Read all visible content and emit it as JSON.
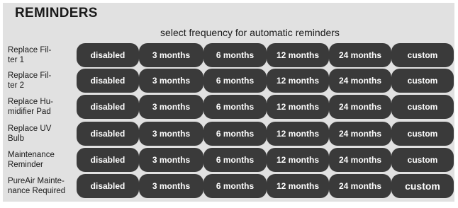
{
  "header": {
    "title": "REMINDERS",
    "subtitle": "select frequency for automatic reminders"
  },
  "options": [
    "disabled",
    "3 months",
    "6 months",
    "12 months",
    "24 months",
    "custom"
  ],
  "rows": [
    {
      "label_line1": "Replace Fil-",
      "label_line2": "ter 1"
    },
    {
      "label_line1": "Replace Fil-",
      "label_line2": "ter 2"
    },
    {
      "label_line1": "Replace Hu-",
      "label_line2": "midifier Pad"
    },
    {
      "label_line1": "Replace UV",
      "label_line2": "Bulb"
    },
    {
      "label_line1": "Maintenance",
      "label_line2": "Reminder"
    },
    {
      "label_line1": "PureAir Mainte-",
      "label_line2": "nance Required"
    }
  ],
  "colors": {
    "panel_bg": "#e1e1e1",
    "button_bg": "#3a3a3a",
    "button_text": "#ffffff"
  }
}
